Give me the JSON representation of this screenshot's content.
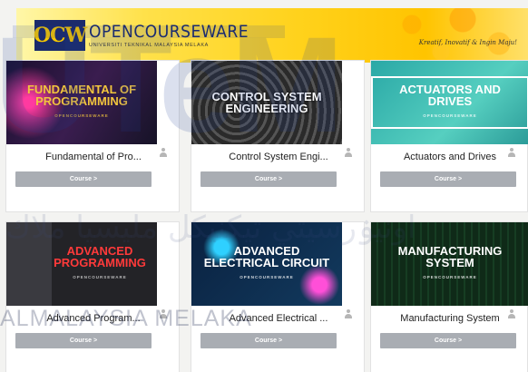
{
  "header": {
    "logo_mark": "OCW",
    "logo_title": "OPENCOURSEWARE",
    "logo_sub": "UNIVERSITI TEKNIKAL MALAYSIA MELAKA",
    "slogan": "Kreatif, Inovatif & Ingin Maju!"
  },
  "watermark": {
    "letters": "UTeM",
    "arabic": "اونيۏرسيتي تيكنيكل مليسيا ملاك",
    "text": "ALMALAYSIA MELAKA"
  },
  "courses": [
    {
      "thumb_label": "Fundamental of Programming",
      "thumb_sub": "OPENCOURSEWARE",
      "title": "Fundamental of Pro...",
      "button": "Course >",
      "thumb_bg": "#2b1a3c",
      "thumb_fg": "#f2c53d"
    },
    {
      "thumb_label": "Control System Engineering",
      "thumb_sub": "",
      "title": "Control System Engi...",
      "button": "Course >",
      "thumb_bg": "#3a3a3a",
      "thumb_fg": "#ffffff"
    },
    {
      "thumb_label": "Actuators and Drives",
      "thumb_sub": "OPENCOURSEWARE",
      "title": "Actuators and Drives",
      "button": "Course >",
      "thumb_bg": "#3cb6b0",
      "thumb_fg": "#ffffff"
    },
    {
      "thumb_label": "Advanced Programming",
      "thumb_sub": "OPENCOURSEWARE",
      "title": "Advanced Program...",
      "button": "Course >",
      "thumb_bg": "#2a2a30",
      "thumb_fg": "#ff3a3a"
    },
    {
      "thumb_label": "Advanced Electrical Circuit",
      "thumb_sub": "OPENCOURSEWARE",
      "title": "Advanced Electrical ...",
      "button": "Course >",
      "thumb_bg": "#0c2b4a",
      "thumb_fg": "#ffffff"
    },
    {
      "thumb_label": "Manufacturing System",
      "thumb_sub": "OPENCOURSEWARE",
      "title": "Manufacturing System",
      "button": "Course >",
      "thumb_bg": "#11331f",
      "thumb_fg": "#ffffff"
    }
  ]
}
